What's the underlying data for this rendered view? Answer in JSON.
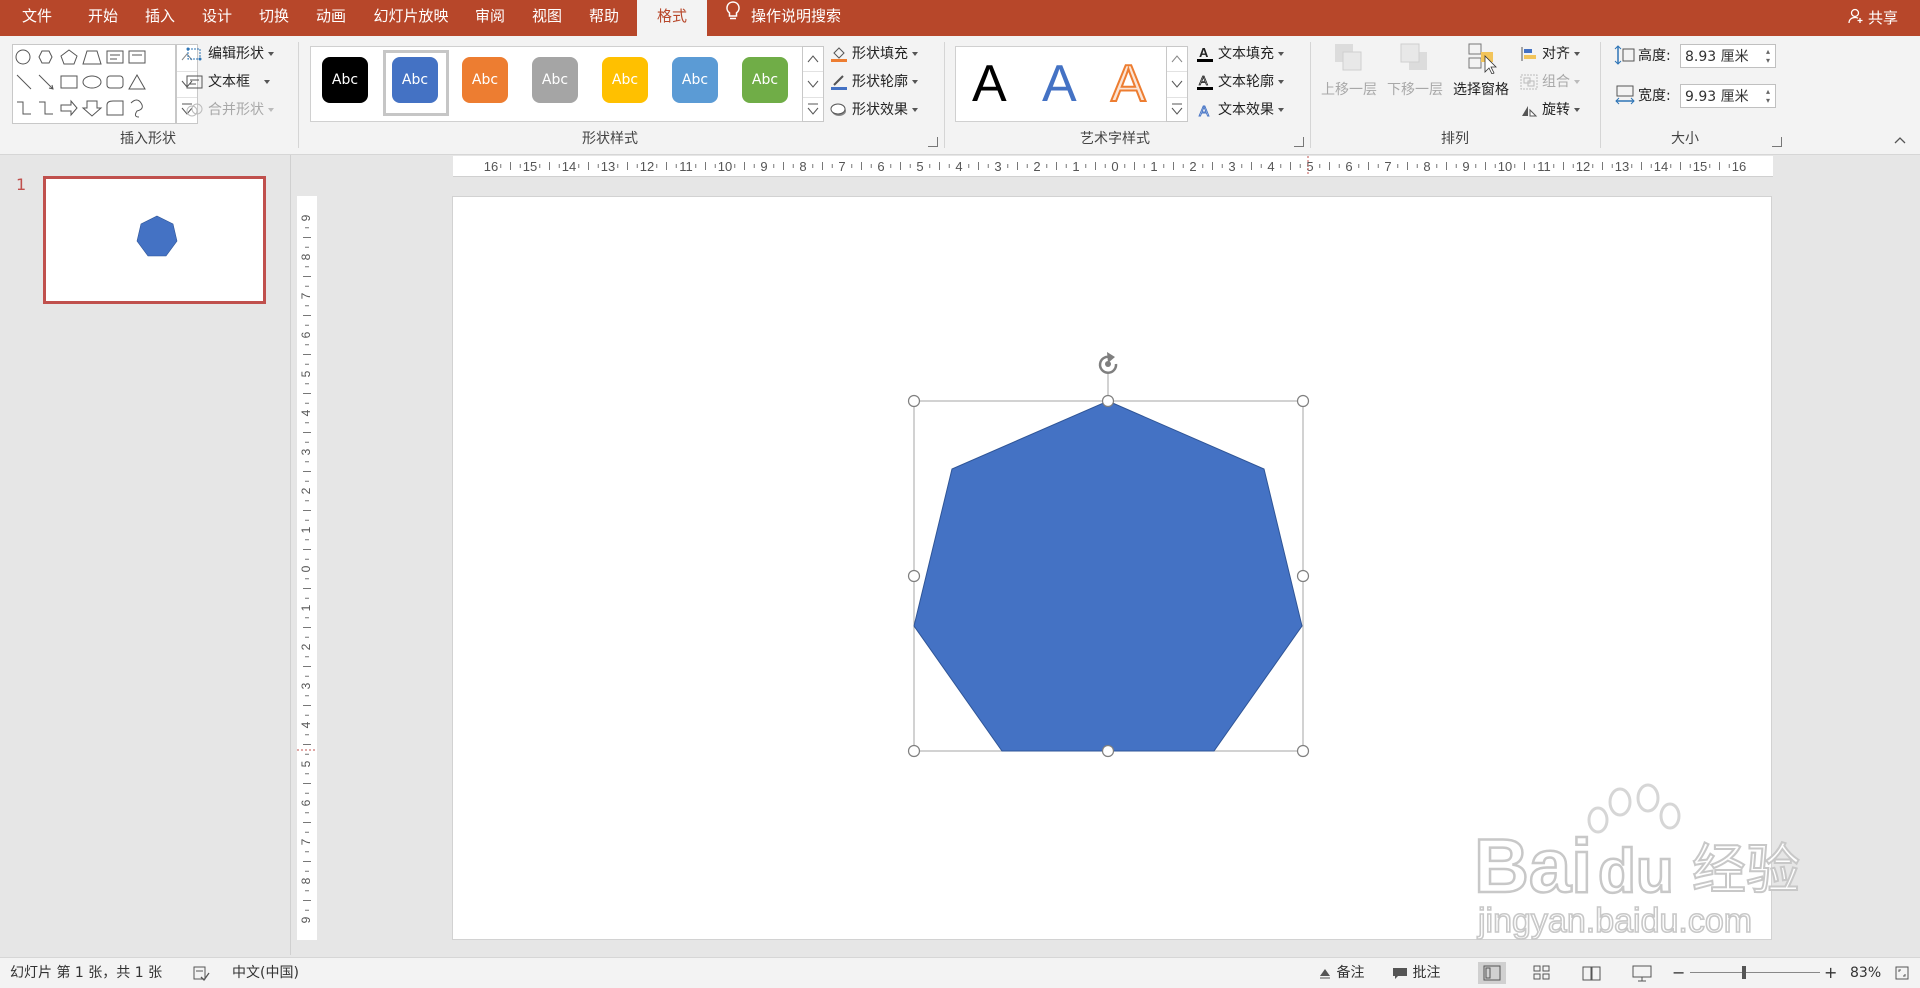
{
  "tabs": [
    {
      "label": "文件",
      "active": false
    },
    {
      "label": "开始",
      "active": false
    },
    {
      "label": "插入",
      "active": false
    },
    {
      "label": "设计",
      "active": false
    },
    {
      "label": "切换",
      "active": false
    },
    {
      "label": "动画",
      "active": false
    },
    {
      "label": "幻灯片放映",
      "active": false
    },
    {
      "label": "审阅",
      "active": false
    },
    {
      "label": "视图",
      "active": false
    },
    {
      "label": "帮助",
      "active": false
    },
    {
      "label": "格式",
      "active": true
    }
  ],
  "tell_me": "操作说明搜索",
  "share": "共享",
  "ribbon": {
    "insert_shapes": {
      "label": "插入形状",
      "edit_shape": "编辑形状",
      "text_box": "文本框",
      "merge_shapes": "合并形状"
    },
    "shape_styles": {
      "label": "形状样式",
      "swatches": [
        {
          "text": "Abc",
          "color": "#000000"
        },
        {
          "text": "Abc",
          "color": "#4472c4"
        },
        {
          "text": "Abc",
          "color": "#ed7d31"
        },
        {
          "text": "Abc",
          "color": "#a5a5a5"
        },
        {
          "text": "Abc",
          "color": "#ffc000"
        },
        {
          "text": "Abc",
          "color": "#5b9bd5"
        },
        {
          "text": "Abc",
          "color": "#70ad47"
        }
      ],
      "selected_index": 1,
      "shape_fill": "形状填充",
      "shape_outline": "形状轮廓",
      "shape_effects": "形状效果"
    },
    "wordart_styles": {
      "label": "艺术字样式",
      "letters": [
        "A",
        "A",
        "A"
      ],
      "text_fill": "文本填充",
      "text_outline": "文本轮廓",
      "text_effects": "文本效果"
    },
    "arrange": {
      "label": "排列",
      "bring_forward": "上移一层",
      "send_backward": "下移一层",
      "selection_pane": "选择窗格",
      "align": "对齐",
      "group": "组合",
      "rotate": "旋转"
    },
    "size": {
      "label": "大小",
      "height_label": "高度:",
      "height_value": "8.93 厘米",
      "width_label": "宽度:",
      "width_value": "9.93 厘米"
    }
  },
  "thumbnail": {
    "slide_number": "1"
  },
  "ruler": {
    "h_labels": [
      "16",
      "15",
      "14",
      "13",
      "12",
      "11",
      "10",
      "9",
      "8",
      "7",
      "6",
      "5",
      "4",
      "3",
      "2",
      "1",
      "0",
      "1",
      "2",
      "3",
      "4",
      "5",
      "6",
      "7",
      "8",
      "9",
      "10",
      "11",
      "12",
      "13",
      "14",
      "15",
      "16"
    ],
    "v_labels": [
      "9",
      "8",
      "7",
      "6",
      "5",
      "4",
      "3",
      "2",
      "1",
      "0",
      "1",
      "2",
      "3",
      "4",
      "5",
      "6",
      "7",
      "8",
      "9"
    ]
  },
  "shape": {
    "type": "heptagon",
    "fill": "#4472c4",
    "stroke": "#2f5597"
  },
  "status": {
    "slide_info": "幻灯片 第 1 张，共 1 张",
    "language": "中文(中国)",
    "notes": "备注",
    "comments": "批注",
    "zoom": "83%"
  },
  "watermark": {
    "brand": "Baidu",
    "cn": "经验",
    "url": "jingyan.baidu.com"
  }
}
